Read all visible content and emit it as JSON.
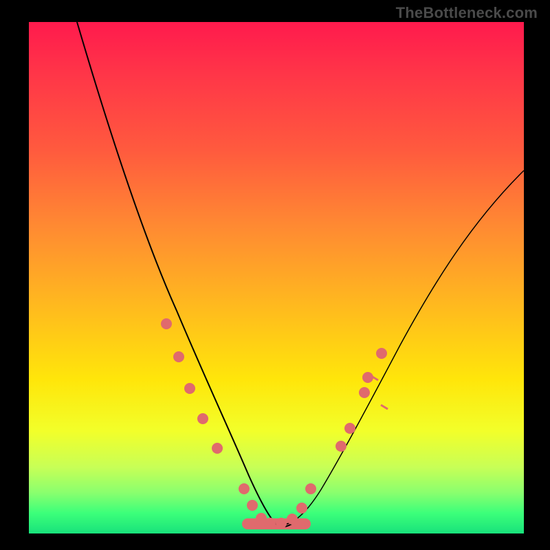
{
  "watermark": "TheBottleneck.com",
  "chart_data": {
    "type": "line",
    "title": "",
    "xlabel": "",
    "ylabel": "",
    "x": [
      0.0,
      0.04,
      0.08,
      0.12,
      0.16,
      0.2,
      0.24,
      0.28,
      0.32,
      0.36,
      0.4,
      0.42,
      0.44,
      0.46,
      0.48,
      0.5,
      0.52,
      0.54,
      0.56,
      0.6,
      0.64,
      0.68,
      0.72,
      0.76,
      0.8,
      0.84,
      0.88,
      0.92,
      0.96,
      1.0
    ],
    "values": [
      1.0,
      0.93,
      0.85,
      0.77,
      0.69,
      0.6,
      0.51,
      0.41,
      0.32,
      0.22,
      0.12,
      0.08,
      0.04,
      0.02,
      0.01,
      0.01,
      0.01,
      0.02,
      0.05,
      0.12,
      0.2,
      0.28,
      0.35,
      0.42,
      0.48,
      0.54,
      0.59,
      0.63,
      0.67,
      0.7
    ],
    "xlim": [
      0,
      1
    ],
    "ylim": [
      0,
      1
    ],
    "grid": false,
    "markers": {
      "left_branch": [
        {
          "x": 0.278,
          "y": 0.41
        },
        {
          "x": 0.303,
          "y": 0.345
        },
        {
          "x": 0.325,
          "y": 0.284
        },
        {
          "x": 0.351,
          "y": 0.225
        },
        {
          "x": 0.38,
          "y": 0.167
        },
        {
          "x": 0.434,
          "y": 0.088
        }
      ],
      "right_branch": [
        {
          "x": 0.57,
          "y": 0.088
        },
        {
          "x": 0.63,
          "y": 0.17
        },
        {
          "x": 0.648,
          "y": 0.205
        },
        {
          "x": 0.678,
          "y": 0.276
        },
        {
          "x": 0.685,
          "y": 0.305
        },
        {
          "x": 0.713,
          "y": 0.352
        }
      ],
      "bottom_flat": [
        {
          "x": 0.451,
          "y": 0.055
        },
        {
          "x": 0.47,
          "y": 0.03
        },
        {
          "x": 0.488,
          "y": 0.02
        },
        {
          "x": 0.51,
          "y": 0.02
        },
        {
          "x": 0.532,
          "y": 0.028
        },
        {
          "x": 0.552,
          "y": 0.05
        }
      ]
    },
    "right_tick_lines_y": [
      0.3,
      0.24
    ],
    "bottom_pink_band": {
      "x0": 0.44,
      "x1": 0.56,
      "y": 0.01,
      "height": 0.02
    }
  }
}
